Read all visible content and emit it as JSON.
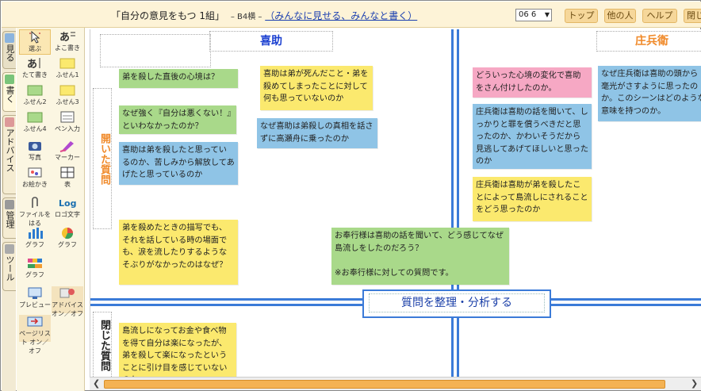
{
  "header": {
    "title_main": "「自分の意見をもつ 1組」",
    "title_paper": "– B4横 –",
    "title_links": "（みんなに見せる、みんなと書く）",
    "select_value": "06 6",
    "buttons": [
      "トップ",
      "他の人",
      "ヘルプ",
      "閉じ"
    ]
  },
  "left_tabs": [
    "見る",
    "書く",
    "アドバイス",
    "管理",
    "ツール"
  ],
  "tools": [
    {
      "label": "選ぶ",
      "icon": "select-icon"
    },
    {
      "label": "よこ書き",
      "icon": "horizontal-text-icon"
    },
    {
      "label": "たて書き",
      "icon": "vertical-text-icon"
    },
    {
      "label": "ふせん1",
      "icon": "sticky-note-icon"
    },
    {
      "label": "ふせん2",
      "icon": "sticky-note-icon"
    },
    {
      "label": "ふせん3",
      "icon": "sticky-note-icon"
    },
    {
      "label": "ふせん4",
      "icon": "sticky-note-icon"
    },
    {
      "label": "ペン入力",
      "icon": "pen-input-icon"
    },
    {
      "label": "写真",
      "icon": "camera-icon"
    },
    {
      "label": "マーカー",
      "icon": "marker-icon"
    },
    {
      "label": "お絵かき",
      "icon": "paint-icon"
    },
    {
      "label": "表",
      "icon": "table-icon"
    },
    {
      "label": "ファイルをはる",
      "icon": "attach-icon"
    },
    {
      "label": "ロゴ文字",
      "icon": "logo-text-icon"
    },
    {
      "label": "グラフ",
      "icon": "bar-chart-icon"
    },
    {
      "label": "グラフ",
      "icon": "pie-chart-icon"
    },
    {
      "label": "グラフ",
      "icon": "band-chart-icon"
    },
    {
      "label": "プレビュー",
      "icon": "preview-icon"
    },
    {
      "label": "アドバイス オン／オフ",
      "icon": "advice-toggle-icon"
    },
    {
      "label": "ページリスト オン／オフ",
      "icon": "page-list-icon"
    }
  ],
  "canvas": {
    "col_left_header": "喜助",
    "col_right_header": "庄兵衛",
    "open_question_label": "開いた質問",
    "closed_question_label": "閉じた質問",
    "center_title": "質問を整理・分析する",
    "notes": [
      {
        "text": "弟を殺した直後の心境は？"
      },
      {
        "text": "喜助は弟が死んだこと・弟を殺めてしまったことに対して何も思っていないのか"
      },
      {
        "text": "なぜ強く『自分は悪くない！』といわなかったのか？"
      },
      {
        "text": "なぜ喜助は弟殺しの真相を話さずに高瀬舟に乗ったのか"
      },
      {
        "text": "喜助は弟を殺したと思っているのか、苦しみから解放してあげたと思っているのか"
      },
      {
        "text": "どういった心境の変化で喜助をさん付けしたのか。"
      },
      {
        "text": "なぜ庄兵衛は喜助の頭から毫光がさすように思ったのか。このシーンはどのような意味を持つのか。"
      },
      {
        "text": "庄兵衛は喜助の話を聞いて、しっかりと罪を償うべきだと思ったのか、かわいそうだから見逃してあげてほしいと思ったのか"
      },
      {
        "text": "庄兵衛は喜助が弟を殺したことによって島流しにされることをどう思ったのか"
      },
      {
        "text": "弟を殺めたときの描写でも、それを話している時の場面でも、涙を流したりするようなそぶりがなかったのはなぜ？"
      },
      {
        "text": "お奉行様は喜助の話を聞いて、どう感じてなぜ島流しをしたのだろう？\n\n※お奉行様に対しての質問です。"
      },
      {
        "text": "島流しになってお金や食べ物を得て自分は楽になったが、弟を殺して楽になったということに引け目を感じていないのか"
      }
    ]
  }
}
